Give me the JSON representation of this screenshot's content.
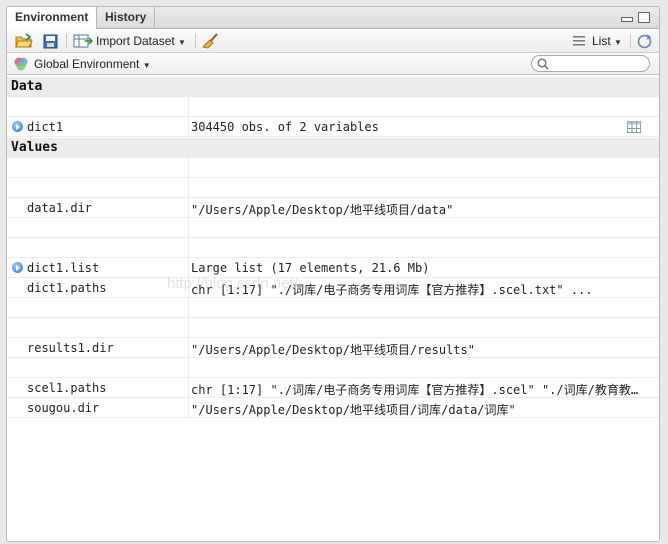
{
  "tabs": [
    {
      "label": "Environment",
      "active": true
    },
    {
      "label": "History",
      "active": false
    }
  ],
  "toolbar": {
    "import_label": "Import Dataset",
    "view_label": "List"
  },
  "env_selector": {
    "label": "Global Environment"
  },
  "search": {
    "placeholder": ""
  },
  "sections": {
    "data": "Data",
    "values": "Values"
  },
  "data_rows": [
    {
      "name": "dict1",
      "value": "304450 obs. of 2 variables",
      "expandable": true
    }
  ],
  "value_rows": [
    {
      "name": "data1.dir",
      "value": "\"/Users/Apple/Desktop/地平线项目/data\""
    },
    {
      "name": "dict1.list",
      "value": "Large list (17 elements, 21.6 Mb)",
      "expandable": true
    },
    {
      "name": "dict1.paths",
      "value": "chr [1:17] \"./词库/电子商务专用词库【官方推荐】.scel.txt\" ..."
    },
    {
      "name": "results1.dir",
      "value": "\"/Users/Apple/Desktop/地平线项目/results\""
    },
    {
      "name": "scel1.paths",
      "value": "chr [1:17] \"./词库/电子商务专用词库【官方推荐】.scel\" \"./词库/教育教…"
    },
    {
      "name": "sougou.dir",
      "value": "\"/Users/Apple/Desktop/地平线项目/词库/data/词库\""
    }
  ],
  "watermark": "http://blog.csdn.net/...",
  "colors": {
    "accent": "#2a72c8",
    "section_bg": "#ececec"
  }
}
